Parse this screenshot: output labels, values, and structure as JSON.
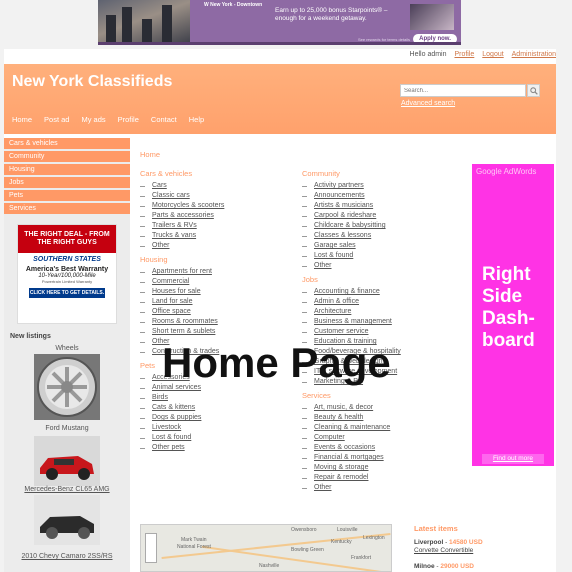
{
  "top_ad": {
    "brand": "W New York - Downtown",
    "headline": "Earn up to 25,000 bonus Starpoints® – enough for a weekend getaway.",
    "apply": "Apply now.",
    "terms": "See rewards for terms details"
  },
  "userbar": {
    "greeting": "Hello admin",
    "profile": "Profile",
    "logout": "Logout",
    "administration": "Administration"
  },
  "header": {
    "title": "New York Classifieds",
    "search_placeholder": "Search...",
    "advanced_search": "Advanced search",
    "nav": [
      "Home",
      "Post ad",
      "My ads",
      "Profile",
      "Contact",
      "Help"
    ]
  },
  "sidebar": {
    "nav": [
      "Cars & vehicles",
      "Community",
      "Housing",
      "Jobs",
      "Pets",
      "Services"
    ],
    "ad": {
      "headline": "THE RIGHT DEAL - FROM THE RIGHT GUYS",
      "logo": "SOUTHERN STATES",
      "warranty": "America's Best Warranty",
      "sub": "10-Year/100,000-Mile",
      "tiny": "Powertrain Limited Warranty",
      "cta": "CLICK HERE TO GET DETAILS."
    },
    "new_listings_title": "New listings",
    "listings": [
      {
        "name": "Wheels",
        "price": "Ford Mustang"
      },
      {
        "name": "Mercedes-Benz CL65 AMG",
        "price": "2010 Chevy Camaro 2SS/RS"
      }
    ]
  },
  "breadcrumb": "Home",
  "categories_left": [
    {
      "title": "Cars & vehicles",
      "items": [
        "Cars",
        "Classic cars",
        "Motorcycles & scooters",
        "Parts & accessories",
        "Trailers & RVs",
        "Trucks & vans",
        "Other"
      ]
    },
    {
      "title": "Housing",
      "items": [
        "Apartments for rent",
        "Commercial",
        "Houses for sale",
        "Land for sale",
        "Office space",
        "Rooms & roommates",
        "Short term & sublets",
        "Other",
        "Construction & trades"
      ]
    },
    {
      "title": "Pets",
      "items": [
        "Accessories",
        "Animal services",
        "Birds",
        "Cats & kittens",
        "Dogs & puppies",
        "Livestock",
        "Lost & found",
        "Other pets"
      ]
    }
  ],
  "categories_right": [
    {
      "title": "Community",
      "items": [
        "Activity partners",
        "Announcements",
        "Artists & musicians",
        "Carpool & rideshare",
        "Childcare & babysitting",
        "Classes & lessons",
        "Garage sales",
        "Lost & found",
        "Other"
      ]
    },
    {
      "title": "Jobs",
      "items": [
        "Accounting & finance",
        "Admin & office",
        "Architecture",
        "Business & management",
        "Customer service",
        "Education & training",
        "Food/beverage & hospitality",
        "Graphic & web design",
        "IT & software development",
        "Marketing & PR"
      ]
    },
    {
      "title": "Services",
      "items": [
        "Art, music, & decor",
        "Beauty & health",
        "Cleaning & maintenance",
        "Computer",
        "Events & occasions",
        "Financial & mortgages",
        "Moving & storage",
        "Repair & remodel",
        "Other"
      ]
    }
  ],
  "overlay_title": "Home Page",
  "map": {
    "labels": [
      "Owensboro",
      "Louisville",
      "Kentucky",
      "Mark Twain",
      "National Forest",
      "Bowling Green",
      "Nashville",
      "Lexington",
      "Frankfort"
    ]
  },
  "latest": {
    "title": "Latest items",
    "items": [
      {
        "location": "Liverpool",
        "price": "14580 USD",
        "name": "Corvette Convertible"
      },
      {
        "location": "Milnoe",
        "price": "29000 USD",
        "name": ""
      }
    ]
  },
  "dashboard": {
    "adwords": "Google AdWords",
    "label": "Right Side Dash-board",
    "find": "Find out more"
  },
  "colors": {
    "accent": "#ff9966",
    "dashboard": "#ff33e5",
    "ad_purple": "#8e6aa4"
  }
}
